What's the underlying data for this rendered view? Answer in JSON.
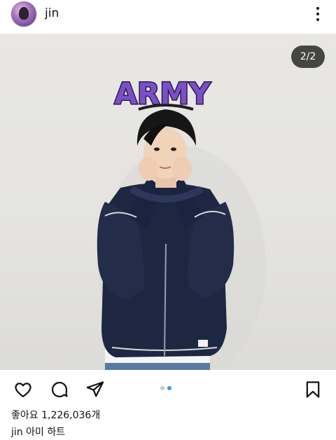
{
  "post": {
    "username": "jin",
    "slide_counter": "2/2",
    "current_slide": 2,
    "total_slides": 2,
    "sticker_text": "ARMY",
    "likes_text": "좋아요 1,226,036개",
    "caption_text": "아미 하트"
  },
  "icons": {
    "more": "more-vertical-icon",
    "like": "heart-icon",
    "comment": "comment-icon",
    "share": "send-icon",
    "save": "bookmark-icon"
  },
  "colors": {
    "accent": "#3897f0",
    "inactive_dot": "#c8c8c8",
    "sticker_fill": "#7b4fc9",
    "sticker_outline": "#2b1a4d"
  }
}
